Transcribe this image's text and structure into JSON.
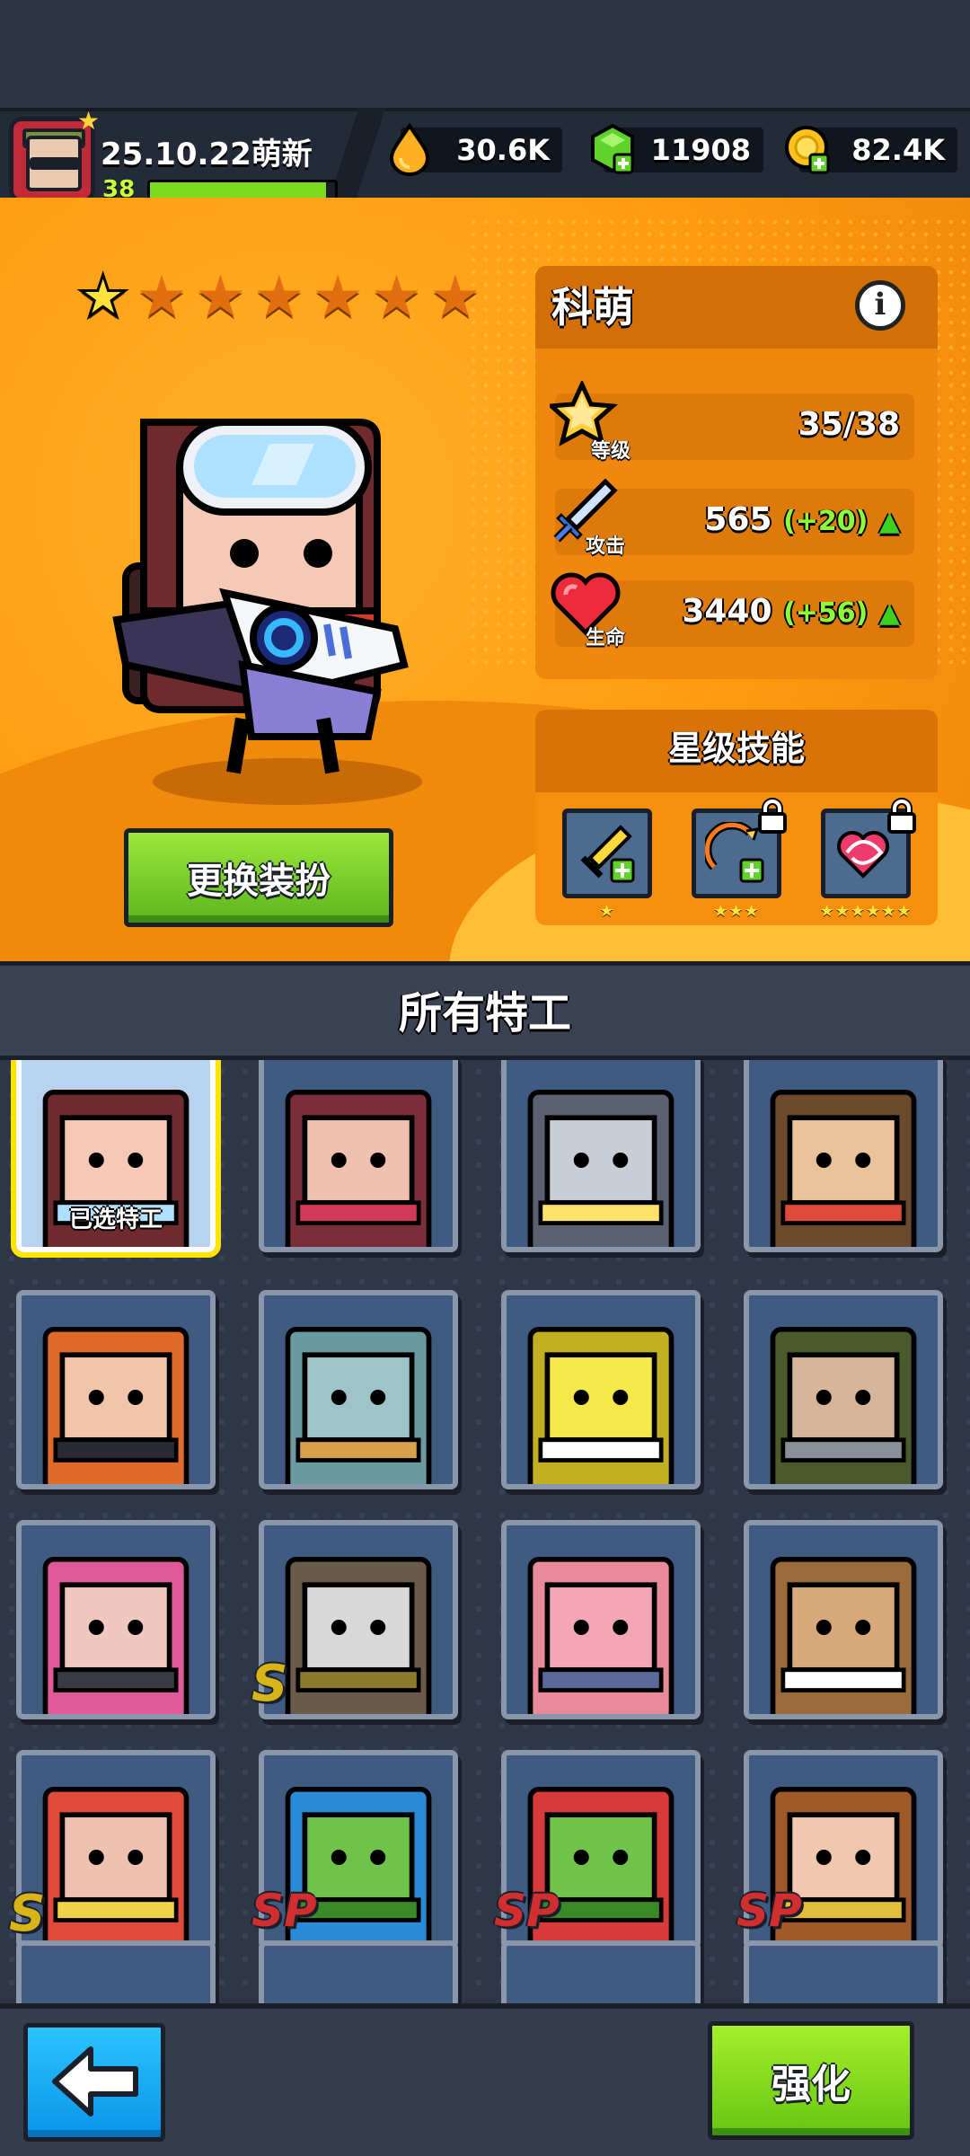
{
  "player": {
    "name": "25.10.22萌新",
    "level": "38",
    "xp_progress": 0.95
  },
  "currencies": [
    {
      "name": "fuel",
      "value": "30.6K",
      "icon": "fuel-drop-icon",
      "color": "#ffb020"
    },
    {
      "name": "gems",
      "value": "11908",
      "icon": "green-gem-icon",
      "color": "#5fd22b"
    },
    {
      "name": "gold",
      "value": "82.4K",
      "icon": "gold-coin-icon",
      "color": "#ffc21a"
    }
  ],
  "hero": {
    "name": "科萌",
    "stars_filled": 1,
    "stars_total": 7,
    "stats": {
      "level": {
        "label": "等级",
        "value": "35/38"
      },
      "attack": {
        "label": "攻击",
        "value": "565",
        "bonus": "(+20)"
      },
      "hp": {
        "label": "生命",
        "value": "3440",
        "bonus": "(+56)"
      }
    },
    "star_skills": {
      "title": "星级技能",
      "skills": [
        {
          "icon": "sword-plus-icon",
          "stars": "★",
          "locked": false
        },
        {
          "icon": "crit-plus-icon",
          "stars": "★★★",
          "locked": true
        },
        {
          "icon": "heart-swirl-icon",
          "stars": "★★★★★★",
          "locked": true
        }
      ]
    },
    "change_skin_label": "更换装扮"
  },
  "agents": {
    "title": "所有特工",
    "selected_label": "已选特工",
    "list": [
      {
        "id": "agent-1",
        "badge": "",
        "selected": true
      },
      {
        "id": "agent-2",
        "badge": ""
      },
      {
        "id": "agent-3",
        "badge": ""
      },
      {
        "id": "agent-4",
        "badge": ""
      },
      {
        "id": "agent-5",
        "badge": ""
      },
      {
        "id": "agent-6",
        "badge": ""
      },
      {
        "id": "agent-7",
        "badge": ""
      },
      {
        "id": "agent-8",
        "badge": ""
      },
      {
        "id": "agent-9",
        "badge": ""
      },
      {
        "id": "agent-10",
        "badge": "S"
      },
      {
        "id": "agent-11",
        "badge": ""
      },
      {
        "id": "agent-12",
        "badge": ""
      },
      {
        "id": "agent-13",
        "badge": "S"
      },
      {
        "id": "agent-14",
        "badge": "SP"
      },
      {
        "id": "agent-15",
        "badge": "SP"
      },
      {
        "id": "agent-16",
        "badge": "SP"
      }
    ]
  },
  "buttons": {
    "enhance": "强化"
  },
  "colors": {
    "accent_orange": "#ff9c10",
    "accent_green": "#7ddb1f",
    "back_blue": "#0a95e8",
    "selected_yellow": "#ffe400"
  }
}
